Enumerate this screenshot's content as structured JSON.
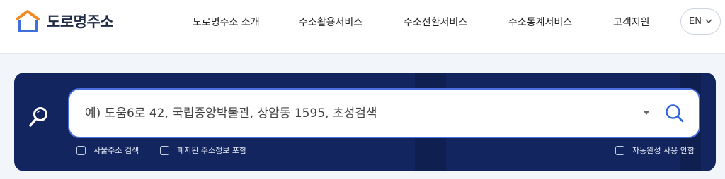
{
  "brand": {
    "name": "도로명주소",
    "icon": "house-logo-icon",
    "colors": {
      "roof_orange": "#f08a24",
      "walls_blue": "#3f6fd8"
    }
  },
  "nav": {
    "items": [
      {
        "label": "도로명주소 소개"
      },
      {
        "label": "주소활용서비스"
      },
      {
        "label": "주소전환서비스"
      },
      {
        "label": "주소통계서비스"
      },
      {
        "label": "고객지원"
      }
    ],
    "language": {
      "label": "EN",
      "icon": "chevron-down-icon"
    }
  },
  "search": {
    "placeholder": "예) 도움6로 42, 국립중앙박물관, 상암동 1595, 초성검색",
    "value": "",
    "lead_icon": "magnifier-icon",
    "submit_icon": "search-icon",
    "dropdown_icon": "caret-down-icon",
    "options": [
      {
        "label": "사물주소 검색",
        "checked": false
      },
      {
        "label": "폐지된 주소정보 포함",
        "checked": false
      },
      {
        "label": "자동완성 사용 안함",
        "checked": false
      }
    ],
    "colors": {
      "panel": "#12255e",
      "border": "#4a6fe0"
    }
  }
}
